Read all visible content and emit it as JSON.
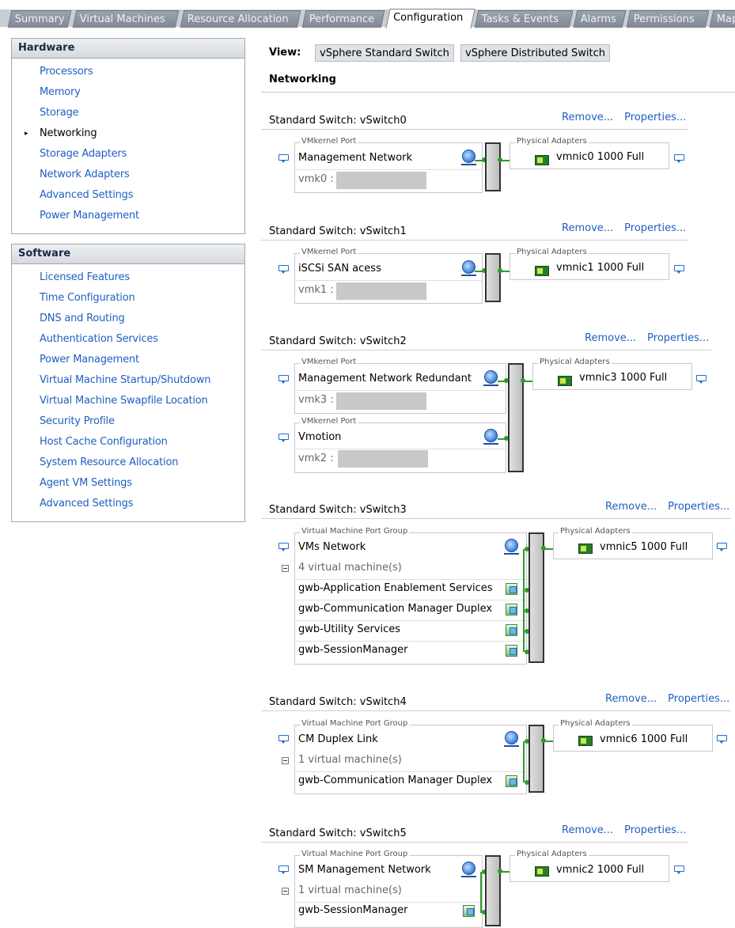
{
  "tabs": [
    "Summary",
    "Virtual Machines",
    "Resource Allocation",
    "Performance",
    "Configuration",
    "Tasks & Events",
    "Alarms",
    "Permissions",
    "Maps"
  ],
  "active_tab": "Configuration",
  "hardware": {
    "title": "Hardware",
    "items": [
      "Processors",
      "Memory",
      "Storage",
      "Networking",
      "Storage Adapters",
      "Network Adapters",
      "Advanced Settings",
      "Power Management"
    ],
    "selected": "Networking"
  },
  "software": {
    "title": "Software",
    "items": [
      "Licensed Features",
      "Time Configuration",
      "DNS and Routing",
      "Authentication Services",
      "Power Management",
      "Virtual Machine Startup/Shutdown",
      "Virtual Machine Swapfile Location",
      "Security Profile",
      "Host Cache Configuration",
      "System Resource Allocation",
      "Agent VM Settings",
      "Advanced Settings"
    ]
  },
  "view": {
    "label": "View:",
    "options": [
      "vSphere Standard Switch",
      "vSphere Distributed Switch"
    ]
  },
  "section_title": "Networking",
  "link_remove": "Remove...",
  "link_properties": "Properties...",
  "caption_vmk": "VMkernel Port",
  "caption_vmpg": "Virtual Machine Port Group",
  "caption_pa": "Physical Adapters",
  "switches": [
    {
      "title": "Standard Switch: vSwitch0",
      "port_name": "Management Network",
      "vmk": "vmk0 :",
      "nic": "vmnic0  1000  Full"
    },
    {
      "title": "Standard Switch: vSwitch1",
      "port_name": "iSCSi SAN acess",
      "vmk": "vmk1 :",
      "nic": "vmnic1  1000  Full"
    },
    {
      "title": "Standard Switch: vSwitch2",
      "port_name": "Management Network Redundant",
      "vmk": "vmk3 :",
      "port2_name": "Vmotion",
      "vmk2": "vmk2 :",
      "nic": "vmnic3  1000  Full"
    },
    {
      "title": "Standard Switch: vSwitch3",
      "port_name": "VMs Network",
      "vm_count": "4 virtual machine(s)",
      "vms": [
        "gwb-Application Enablement Services",
        "gwb-Communication Manager Duplex",
        "gwb-Utility Services",
        "gwb-SessionManager"
      ],
      "nic": "vmnic5  1000  Full"
    },
    {
      "title": "Standard Switch: vSwitch4",
      "port_name": "CM Duplex Link",
      "vm_count": "1 virtual machine(s)",
      "vms": [
        "gwb-Communication Manager Duplex"
      ],
      "nic": "vmnic6  1000  Full"
    },
    {
      "title": "Standard Switch: vSwitch5",
      "port_name": "SM Management Network",
      "vm_count": "1 virtual machine(s)",
      "vms": [
        "gwb-SessionManager"
      ],
      "nic": "vmnic2  1000  Full"
    }
  ]
}
